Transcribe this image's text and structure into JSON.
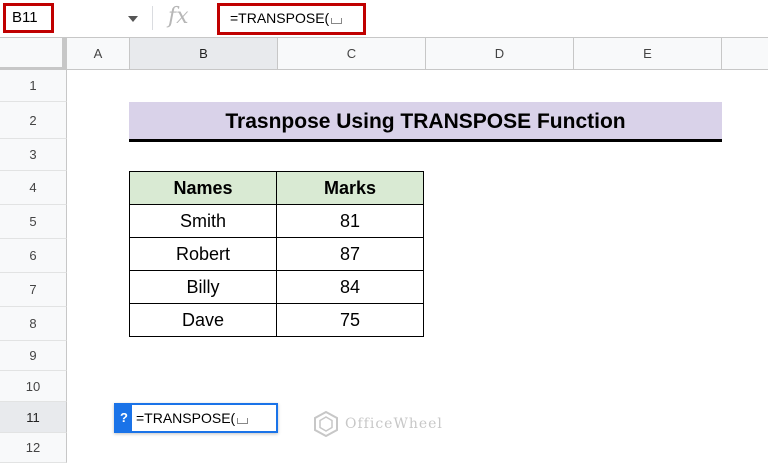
{
  "formula_bar": {
    "name_box": "B11",
    "fx_symbol": "fx",
    "formula": "=TRANSPOSE("
  },
  "columns": [
    "A",
    "B",
    "C",
    "D",
    "E"
  ],
  "selected_column": "B",
  "rows": [
    "1",
    "2",
    "3",
    "4",
    "5",
    "6",
    "7",
    "8",
    "9",
    "10",
    "11",
    "12"
  ],
  "selected_row": "11",
  "sheet": {
    "title": "Trasnpose Using TRANSPOSE Function",
    "table": {
      "headers": [
        "Names",
        "Marks"
      ],
      "rows": [
        [
          "Smith",
          "81"
        ],
        [
          "Robert",
          "87"
        ],
        [
          "Billy",
          "84"
        ],
        [
          "Dave",
          "75"
        ]
      ]
    },
    "active_cell": {
      "help_icon": "?",
      "text": "=TRANSPOSE("
    }
  },
  "watermark": {
    "text": "OfficeWheel",
    "icon": "officewheel-logo"
  },
  "colors": {
    "highlight": "#c00000",
    "title_bg": "#d9d2e9",
    "header_bg": "#d9ead3",
    "active_border": "#1a73e8"
  }
}
